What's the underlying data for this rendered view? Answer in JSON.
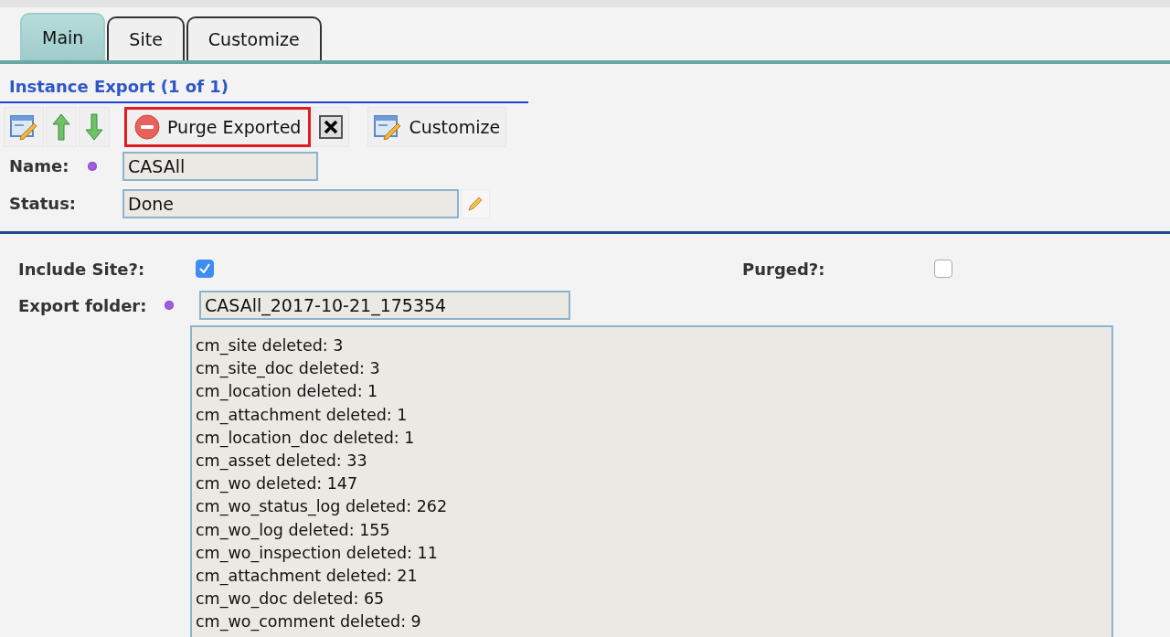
{
  "tabs": [
    {
      "label": "Main",
      "selected": true
    },
    {
      "label": "Site",
      "selected": false
    },
    {
      "label": "Customize",
      "selected": false
    }
  ],
  "title": "Instance Export (1 of 1)",
  "toolbar": [
    {
      "kind": "edit",
      "highlighted": false
    },
    {
      "kind": "up",
      "highlighted": false
    },
    {
      "kind": "down",
      "highlighted": false
    },
    {
      "kind": "purge",
      "label": "Purge Exported",
      "highlighted": true
    },
    {
      "kind": "delete",
      "highlighted": false
    },
    {
      "kind": "customize",
      "label": "Customize",
      "highlighted": false
    }
  ],
  "header_fields": [
    {
      "label": "Name:",
      "required": true,
      "value": "CASAll",
      "editable": false
    },
    {
      "label": "Status:",
      "required": false,
      "value": "Done",
      "editable": true
    }
  ],
  "include_site": {
    "label": "Include Site?:",
    "checked": true
  },
  "purged": {
    "label": "Purged?:",
    "checked": false
  },
  "export_folder": {
    "label": "Export folder:",
    "required": true,
    "value": "CASAll_2017-10-21_175354"
  },
  "log": [
    "cm_site deleted: 3",
    "cm_site_doc deleted: 3",
    "cm_location deleted: 1",
    "cm_attachment deleted: 1",
    "cm_location_doc deleted: 1",
    "cm_asset deleted: 33",
    "cm_wo deleted: 147",
    "cm_wo_status_log deleted: 262",
    "cm_wo_log deleted: 155",
    "cm_wo_inspection deleted: 11",
    "cm_attachment deleted: 21",
    "cm_wo_doc deleted: 65",
    "cm_wo_comment deleted: 9"
  ]
}
